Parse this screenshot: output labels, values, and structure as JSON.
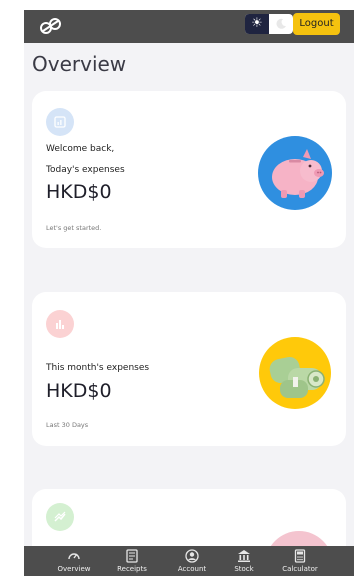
{
  "header": {
    "logout_label": "Logout",
    "theme_toggle": {
      "light_icon": "sun-icon",
      "dark_icon": "moon-icon",
      "selected": "light"
    }
  },
  "page": {
    "title": "Overview"
  },
  "cards": [
    {
      "icon": "chart-icon",
      "welcome": "Welcome back,",
      "label": "Today's expenses",
      "amount": "HKD$0",
      "footer": "Let's get started.",
      "illustration": "piggy-bank"
    },
    {
      "icon": "bar-chart-icon",
      "label": "This month's expenses",
      "amount": "HKD$0",
      "footer": "Last 30 Days",
      "illustration": "money-rolls"
    },
    {
      "icon": "trend-icon",
      "illustration": "pink-circle"
    }
  ],
  "nav": {
    "items": [
      {
        "label": "Overview",
        "icon": "speedometer-icon"
      },
      {
        "label": "Receipts",
        "icon": "receipt-icon"
      },
      {
        "label": "Account",
        "icon": "account-icon"
      },
      {
        "label": "Stock",
        "icon": "bank-icon"
      },
      {
        "label": "Calculator",
        "icon": "calculator-icon"
      }
    ]
  },
  "colors": {
    "accent": "#f5c20f",
    "topbar": "#4d4d4d",
    "background": "#f3f3f6",
    "card1_badge": "#d5e4f7",
    "card2_badge": "#fbd2d3",
    "card3_badge": "#d4f0d1"
  }
}
